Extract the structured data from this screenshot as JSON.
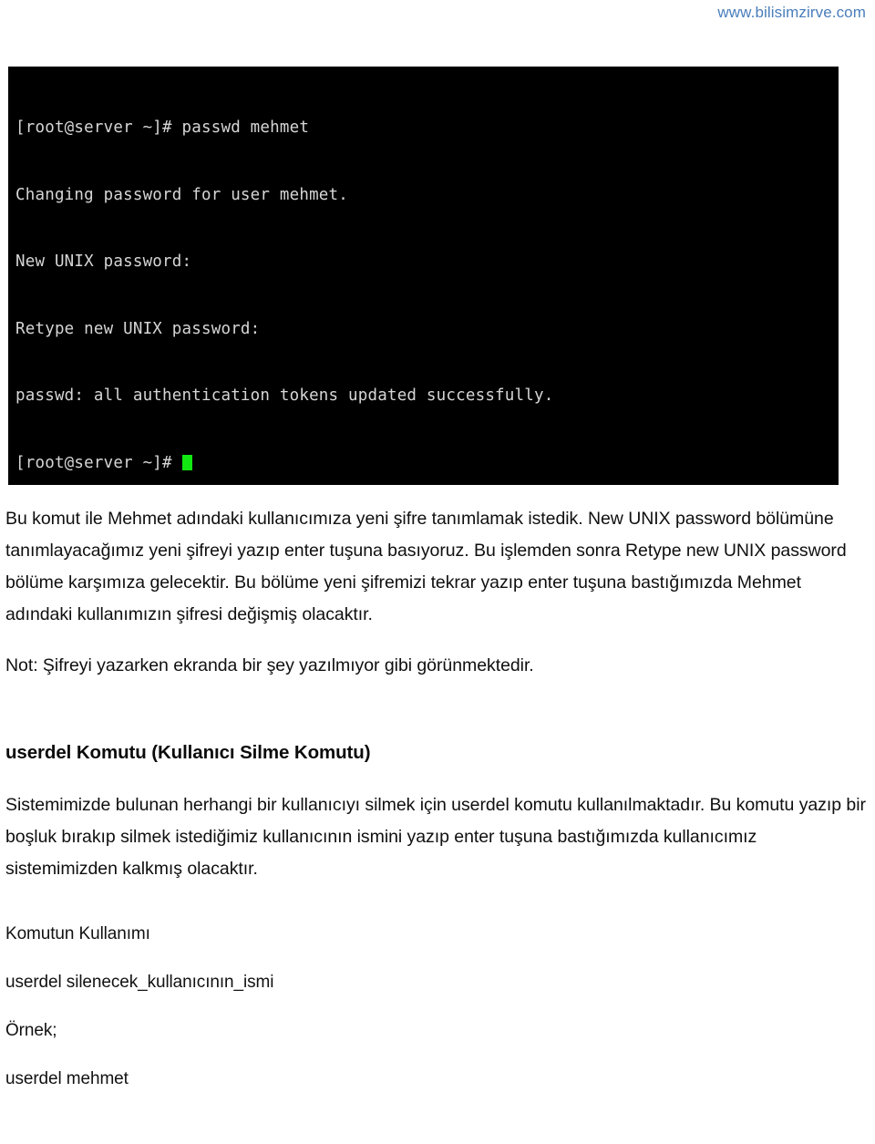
{
  "header": {
    "wordmark": "www.bilisimzirve.com",
    "accent_color": "#4a7ebb"
  },
  "terminal": {
    "background_color": "#000000",
    "text_color": "#d6d6d6",
    "cursor_color": "#12e712",
    "lines": [
      "[root@server ~]# passwd mehmet",
      "Changing password for user mehmet.",
      "New UNIX password:",
      "Retype new UNIX password:",
      "passwd: all authentication tokens updated successfully.",
      "[root@server ~]# "
    ],
    "prompt_last": "[root@server ~]# "
  },
  "document": {
    "paragraph_1": "Bu komut ile Mehmet adındaki kullanıcımıza yeni şifre tanımlamak istedik. New UNIX password bölümüne tanımlayacağımız yeni şifreyi yazıp enter tuşuna basıyoruz. Bu işlemden sonra Retype new UNIX password bölüme karşımıza gelecektir. Bu bölüme yeni şifremizi tekrar yazıp enter tuşuna bastığımızda Mehmet adındaki kullanımızın şifresi değişmiş olacaktır.",
    "note": "Not: Şifreyi yazarken ekranda bir şey yazılmıyor gibi görünmektedir.",
    "section_heading": "userdel Komutu (Kullanıcı Silme Komutu)",
    "paragraph_2": "Sistemimizde bulunan herhangi bir kullanıcıyı silmek için userdel komutu kullanılmaktadır. Bu komutu yazıp bir boşluk bırakıp silmek istediğimiz kullanıcının ismini yazıp enter tuşuna bastığımızda kullanıcımız sistemimizden kalkmış olacaktır.",
    "usage_label": "Komutun Kullanımı",
    "usage_syntax": "userdel silenecek_kullanıcının_ismi",
    "example_label": "Örnek;",
    "example_command": "userdel mehmet"
  }
}
